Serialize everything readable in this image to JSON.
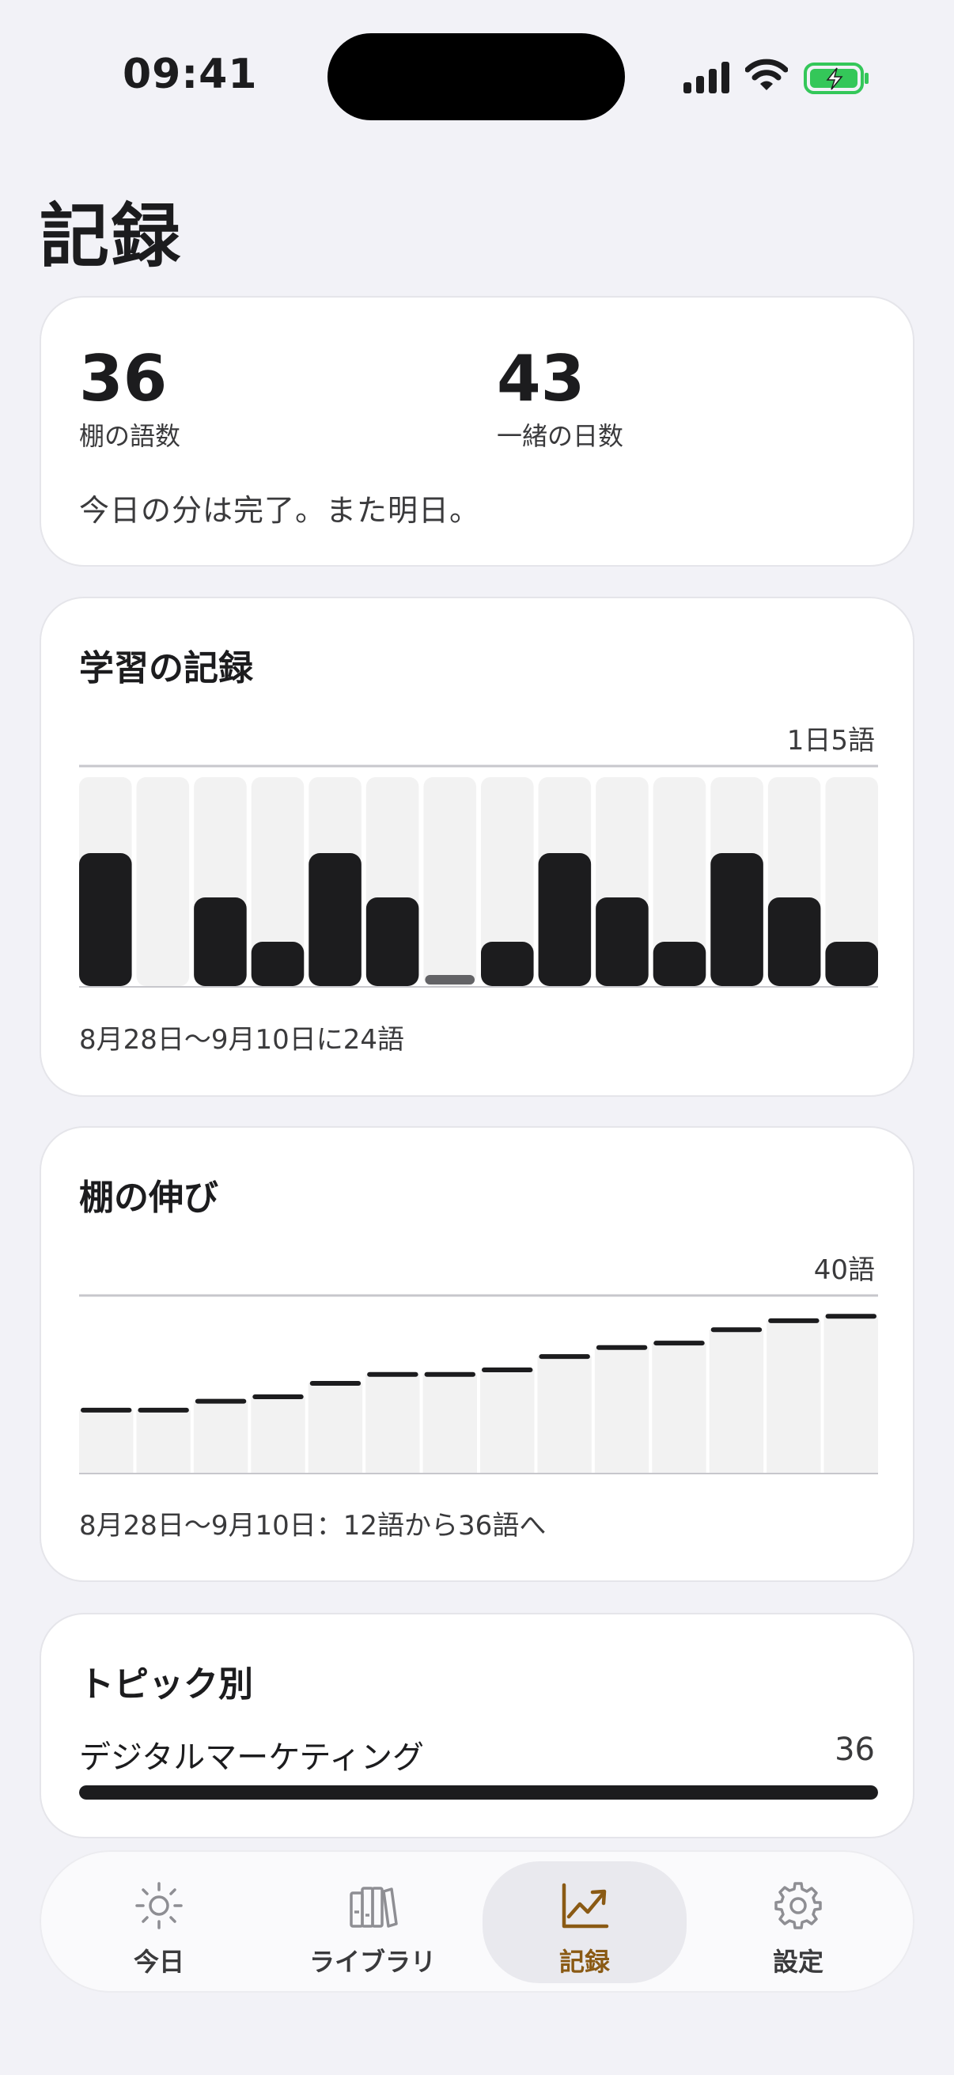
{
  "status": {
    "time": "09:41"
  },
  "page": {
    "title": "記録"
  },
  "summary": {
    "words_value": "36",
    "words_label": "棚の語数",
    "days_value": "43",
    "days_label": "一緒の日数",
    "message": "今日の分は完了。また明日。"
  },
  "study": {
    "title": "学習の記録",
    "cap_label": "1日5語",
    "footer": "8月28日～9月10日に24語",
    "chart_data": {
      "type": "bar",
      "max": 5,
      "values": [
        3,
        0,
        2,
        1,
        3,
        2,
        0,
        1,
        3,
        2,
        1,
        3,
        2,
        1
      ],
      "today_index": 6
    }
  },
  "shelf": {
    "title": "棚の伸び",
    "cap_label": "40語",
    "footer": "8月28日～9月10日：12語から36語へ",
    "chart_data": {
      "type": "bar",
      "max": 40,
      "values": [
        14,
        14,
        16,
        17,
        20,
        22,
        22,
        23,
        26,
        28,
        29,
        32,
        34,
        35
      ]
    }
  },
  "topics": {
    "title": "トピック別",
    "items": [
      {
        "name": "デジタルマーケティング",
        "count": "36",
        "fraction": 1.0
      }
    ]
  },
  "tabs": [
    {
      "label": "今日",
      "icon": "sun-icon"
    },
    {
      "label": "ライブラリ",
      "icon": "books-icon"
    },
    {
      "label": "記録",
      "icon": "chart-icon",
      "active": true
    },
    {
      "label": "設定",
      "icon": "gear-icon"
    }
  ],
  "colors": {
    "bar": "#1c1c1e",
    "track": "#f2f2f2",
    "today_marker": "#636366",
    "accent": "#8a5a14"
  }
}
